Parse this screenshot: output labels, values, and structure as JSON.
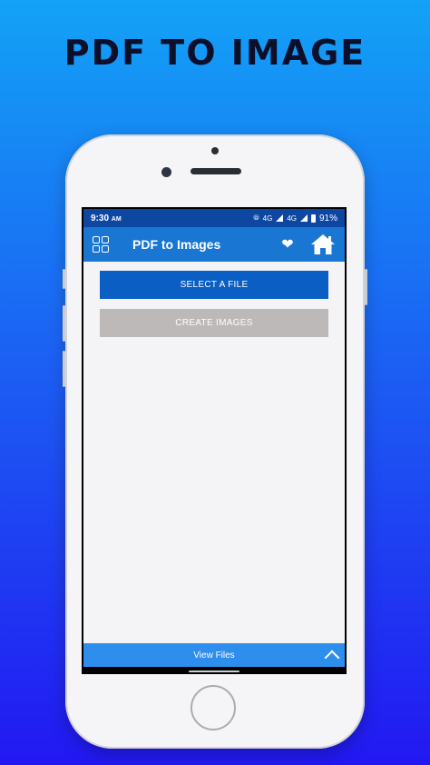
{
  "promo": {
    "title": "PDF TO IMAGE"
  },
  "status_bar": {
    "time": "9:30",
    "ampm": "AM",
    "network1": "4G",
    "network2": "4G",
    "battery": "91%"
  },
  "app_bar": {
    "title": "PDF to Images"
  },
  "buttons": {
    "select_file": "SELECT A FILE",
    "create_images": "CREATE IMAGES"
  },
  "bottom_bar": {
    "label": "View Files"
  },
  "colors": {
    "status_bar": "#0d47a1",
    "app_bar": "#1976d2",
    "primary_button": "#0b5ec4",
    "disabled_button": "#bdb9b8",
    "bottom_bar": "#2e8eed"
  },
  "icons": [
    "grid-menu-icon",
    "heart-icon",
    "home-icon",
    "chevron-up-icon"
  ]
}
